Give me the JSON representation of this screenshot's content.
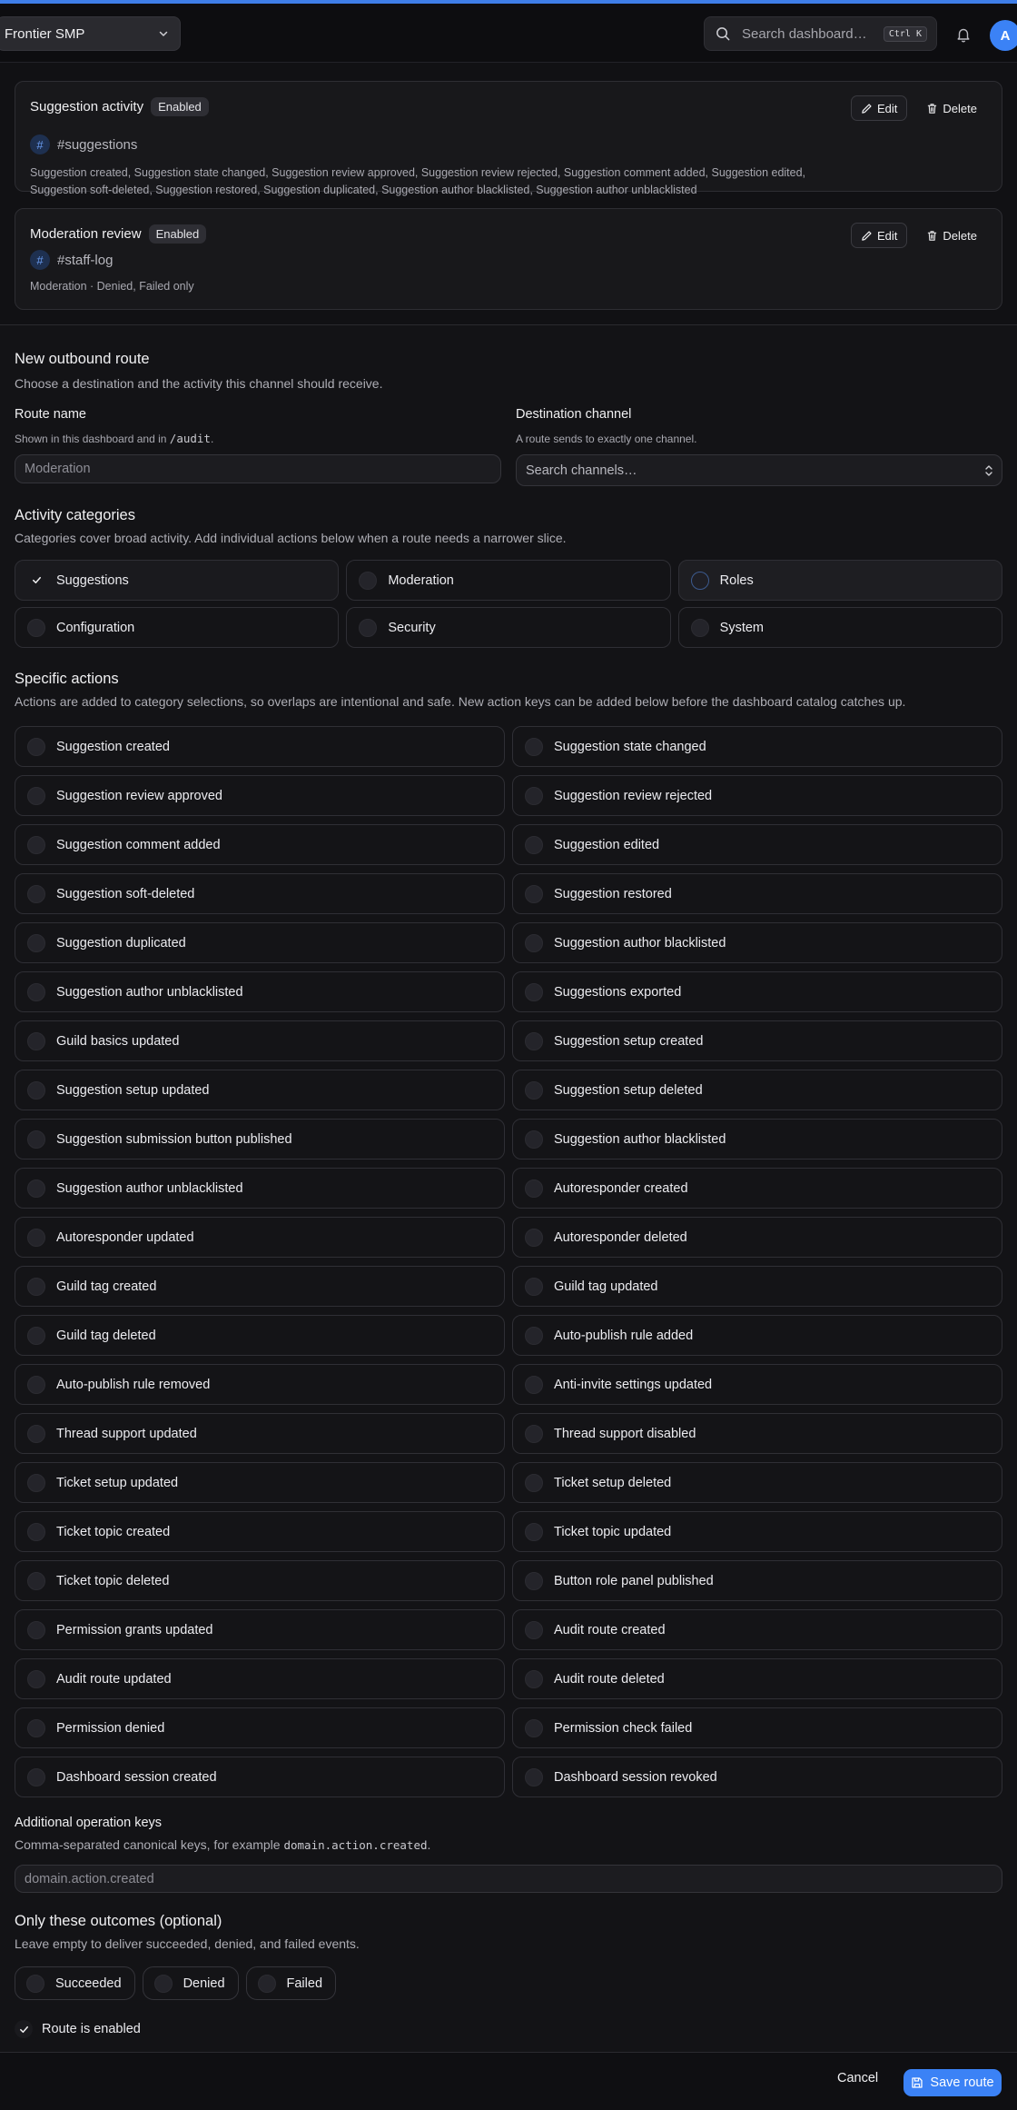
{
  "header": {
    "server_name": "Frontier SMP",
    "search_placeholder": "Search dashboard…",
    "search_shortcut": "Ctrl K",
    "avatar_initial": "A",
    "accent_color": "#3b82f6"
  },
  "routes": [
    {
      "name": "Suggestion activity",
      "status": "Enabled",
      "channel": "#suggestions",
      "events": "Suggestion created, Suggestion state changed, Suggestion review approved, Suggestion review rejected, Suggestion comment added, Suggestion edited, Suggestion soft-deleted, Suggestion restored, Suggestion duplicated, Suggestion author blacklisted, Suggestion author unblacklisted",
      "edit_label": "Edit",
      "delete_label": "Delete"
    },
    {
      "name": "Moderation review",
      "status": "Enabled",
      "channel": "#staff-log",
      "events": "Moderation · Denied, Failed only",
      "edit_label": "Edit",
      "delete_label": "Delete"
    }
  ],
  "form": {
    "title": "New outbound route",
    "description": "Choose a destination and the activity this channel should receive.",
    "route_name_label": "Route name",
    "route_name_hint_prefix": "Shown in this dashboard and in",
    "route_name_hint_code": "/audit",
    "route_name_hint_suffix": ".",
    "route_name_placeholder": "Moderation",
    "destination_label": "Destination channel",
    "destination_hint": "A route sends to exactly one channel.",
    "destination_placeholder": "Search channels…",
    "categories_title": "Activity categories",
    "categories_description": "Categories cover broad activity. Add individual actions below when a route needs a narrower slice.",
    "categories": [
      {
        "label": "Suggestions",
        "selected": true
      },
      {
        "label": "Moderation",
        "selected": false
      },
      {
        "label": "Roles",
        "selected": false,
        "focused": true
      },
      {
        "label": "Configuration",
        "selected": false
      },
      {
        "label": "Security",
        "selected": false
      },
      {
        "label": "System",
        "selected": false
      }
    ],
    "actions_title": "Specific actions",
    "actions_description": "Actions are added to category selections, so overlaps are intentional and safe. New action keys can be added below before the dashboard catalog catches up.",
    "actions": [
      "Suggestion created",
      "Suggestion state changed",
      "Suggestion review approved",
      "Suggestion review rejected",
      "Suggestion comment added",
      "Suggestion edited",
      "Suggestion soft-deleted",
      "Suggestion restored",
      "Suggestion duplicated",
      "Suggestion author blacklisted",
      "Suggestion author unblacklisted",
      "Suggestions exported",
      "Guild basics updated",
      "Suggestion setup created",
      "Suggestion setup updated",
      "Suggestion setup deleted",
      "Suggestion submission button published",
      "Suggestion author blacklisted",
      "Suggestion author unblacklisted",
      "Autoresponder created",
      "Autoresponder updated",
      "Autoresponder deleted",
      "Guild tag created",
      "Guild tag updated",
      "Guild tag deleted",
      "Auto-publish rule added",
      "Auto-publish rule removed",
      "Anti-invite settings updated",
      "Thread support updated",
      "Thread support disabled",
      "Ticket setup updated",
      "Ticket setup deleted",
      "Ticket topic created",
      "Ticket topic updated",
      "Ticket topic deleted",
      "Button role panel published",
      "Permission grants updated",
      "Audit route created",
      "Audit route updated",
      "Audit route deleted",
      "Permission denied",
      "Permission check failed",
      "Dashboard session created",
      "Dashboard session revoked"
    ],
    "additional_keys_label": "Additional operation keys",
    "additional_keys_desc_prefix": "Comma-separated canonical keys, for example",
    "additional_keys_desc_code": "domain.action.created",
    "additional_keys_desc_suffix": ".",
    "additional_keys_placeholder": "domain.action.created",
    "outcomes_title": "Only these outcomes (optional)",
    "outcomes_description": "Leave empty to deliver succeeded, denied, and failed events.",
    "outcomes": [
      "Succeeded",
      "Denied",
      "Failed"
    ],
    "enabled_label": "Route is enabled",
    "enabled": true
  },
  "footer": {
    "cancel_label": "Cancel",
    "save_label": "Save route"
  }
}
